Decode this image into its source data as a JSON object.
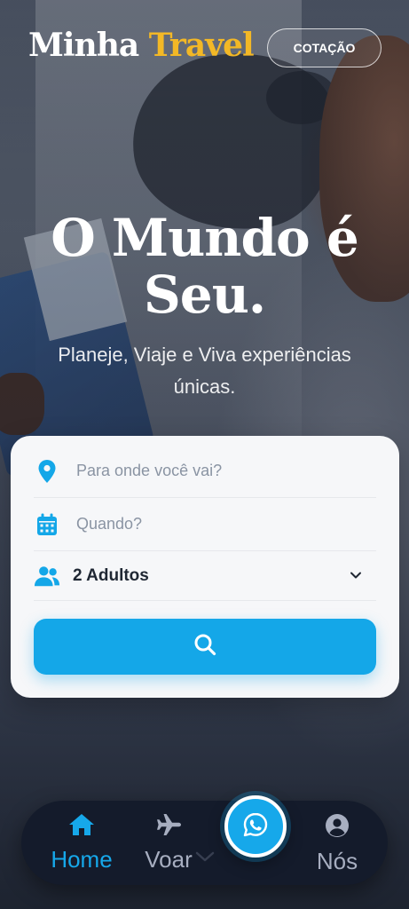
{
  "header": {
    "logo_main": "Minha",
    "logo_accent": "Travel",
    "quote_button": "COTAÇÃO"
  },
  "hero": {
    "title_line1": "O Mundo é",
    "title_line2": "Seu.",
    "subtitle": "Planeje, Viaje e Viva experiências únicas."
  },
  "search": {
    "destination_placeholder": "Para onde você vai?",
    "date_placeholder": "Quando?",
    "guests_value": "2 Adultos",
    "icons": {
      "destination": "map-pin-icon",
      "date": "calendar-icon",
      "guests": "users-icon",
      "submit": "search-icon"
    }
  },
  "nav": {
    "items": [
      {
        "label": "Home",
        "icon": "home-icon",
        "active": true
      },
      {
        "label": "Voar",
        "icon": "plane-icon",
        "active": false
      },
      {
        "label": "Nós",
        "icon": "user-circle-icon",
        "active": false
      }
    ],
    "center_button_icon": "whatsapp-icon"
  },
  "colors": {
    "accent": "#14a7e8",
    "logo_accent": "#f3b826",
    "nav_bg": "#141b2b",
    "card_bg": "#f6f7f9"
  }
}
